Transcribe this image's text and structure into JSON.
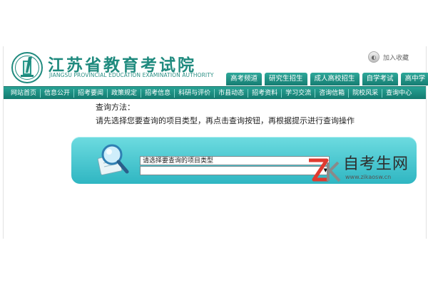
{
  "header": {
    "title_cn": "江苏省教育考试院",
    "title_en": "JIANGSU PROVINCIAL EDUCATION EXAMINATION AUTHORITY",
    "favorite_label": "加入收藏"
  },
  "tabs": [
    {
      "label": "高考频道"
    },
    {
      "label": "研究生招生"
    },
    {
      "label": "成人高校招生"
    },
    {
      "label": "自学考试"
    },
    {
      "label": "高中学"
    }
  ],
  "nav": [
    {
      "label": "网站首页"
    },
    {
      "label": "信息公开"
    },
    {
      "label": "招考要闻"
    },
    {
      "label": "政策规定"
    },
    {
      "label": "招考信息"
    },
    {
      "label": "科研与评价"
    },
    {
      "label": "市县动态"
    },
    {
      "label": "招考资料"
    },
    {
      "label": "学习交流"
    },
    {
      "label": "咨询信箱"
    },
    {
      "label": "院校风采"
    },
    {
      "label": "查询中心"
    }
  ],
  "query": {
    "method_title": "查询方法：",
    "method_text": "请先选择您要查询的项目类型，再点击查询按钮，再根据提示进行查询操作",
    "select_value": "请选择要查询的项目类型",
    "select_arrow": "▼"
  },
  "watermark": {
    "text": "自考生网",
    "url": "www.zikaosw.cn"
  },
  "colors": {
    "brand": "#1f8a7e",
    "nav_bg": "#1a8a7e",
    "panel": "#3cc2cc",
    "watermark_red": "#e03a2f"
  }
}
